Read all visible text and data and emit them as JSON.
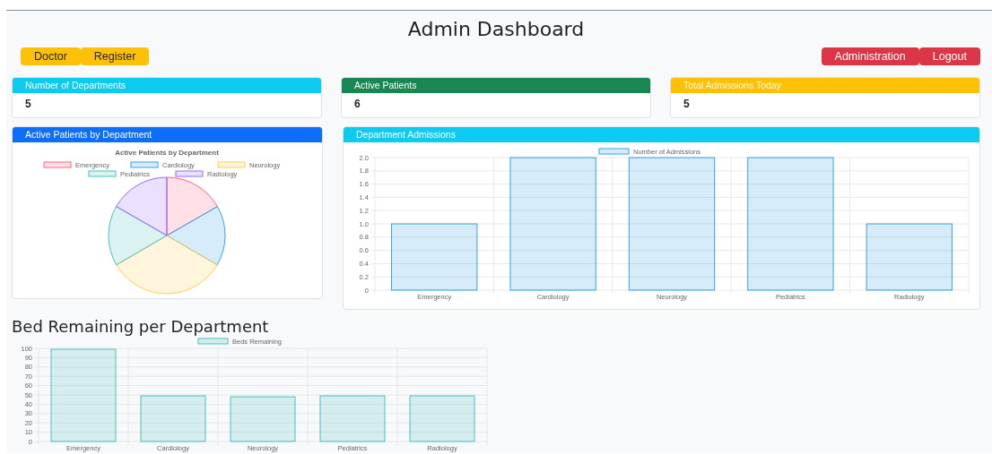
{
  "title": "Admin Dashboard",
  "left_buttons": [
    {
      "label": "Doctor",
      "color": "#ffc107"
    },
    {
      "label": "Register",
      "color": "#ffc107"
    }
  ],
  "right_buttons": [
    {
      "label": "Administration",
      "color": "#dc3545"
    },
    {
      "label": "Logout",
      "color": "#dc3545"
    }
  ],
  "stat_cards": [
    {
      "title": "Number of Departments",
      "value": "5",
      "color": "#0dcaf0"
    },
    {
      "title": "Active Patients",
      "value": "6",
      "color": "#198754"
    },
    {
      "title": "Total Admissions Today",
      "value": "5",
      "color": "#ffc107"
    }
  ],
  "patients_card": {
    "title": "Active Patients by Department",
    "color": "#0d6efd",
    "chart_data": {
      "type": "pie",
      "title": "Active Patients by Department",
      "categories": [
        "Emergency",
        "Cardiology",
        "Neurology",
        "Pediatrics",
        "Radiology"
      ],
      "colors": [
        "#ff6384",
        "#36a2eb",
        "#ffce56",
        "#4bc0c0",
        "#9966ff"
      ],
      "legend": true,
      "series": [
        {
          "values": [
            16.7,
            16.7,
            33.2,
            16.7,
            16.7
          ]
        }
      ]
    }
  },
  "admissions_card": {
    "title": "Department Admissions",
    "color": "#0dcaf0",
    "chart_data": {
      "type": "bar",
      "categories": [
        "Emergency",
        "Cardiology",
        "Neurology",
        "Pediatrics",
        "Radiology"
      ],
      "series": [
        {
          "name": "Number of Admissions",
          "color": "#36a2eb",
          "values": [
            1,
            2,
            2,
            2,
            1
          ]
        }
      ],
      "ylim": [
        0,
        2
      ],
      "grid": true,
      "legend": true,
      "yticks": [
        0,
        0.2,
        0.4,
        0.6,
        0.8,
        {
          "value": 1,
          "label": "1.0"
        },
        1.2,
        1.4,
        1.6,
        1.8,
        {
          "value": 2,
          "label": "2.0"
        }
      ]
    }
  },
  "beds": {
    "heading": "Bed Remaining per Department",
    "chart_data": {
      "type": "bar",
      "categories": [
        "Emergency",
        "Cardiology",
        "Neurology",
        "Pediatrics",
        "Radiology"
      ],
      "series": [
        {
          "name": "Beds Remaining",
          "color": "#4bc0c0",
          "values": [
            99,
            49,
            48,
            49,
            49
          ]
        }
      ],
      "ylim": [
        0,
        100
      ],
      "grid": true,
      "legend": true,
      "yticks": [
        0,
        10,
        20,
        30,
        40,
        50,
        60,
        70,
        80,
        90,
        100
      ]
    }
  }
}
